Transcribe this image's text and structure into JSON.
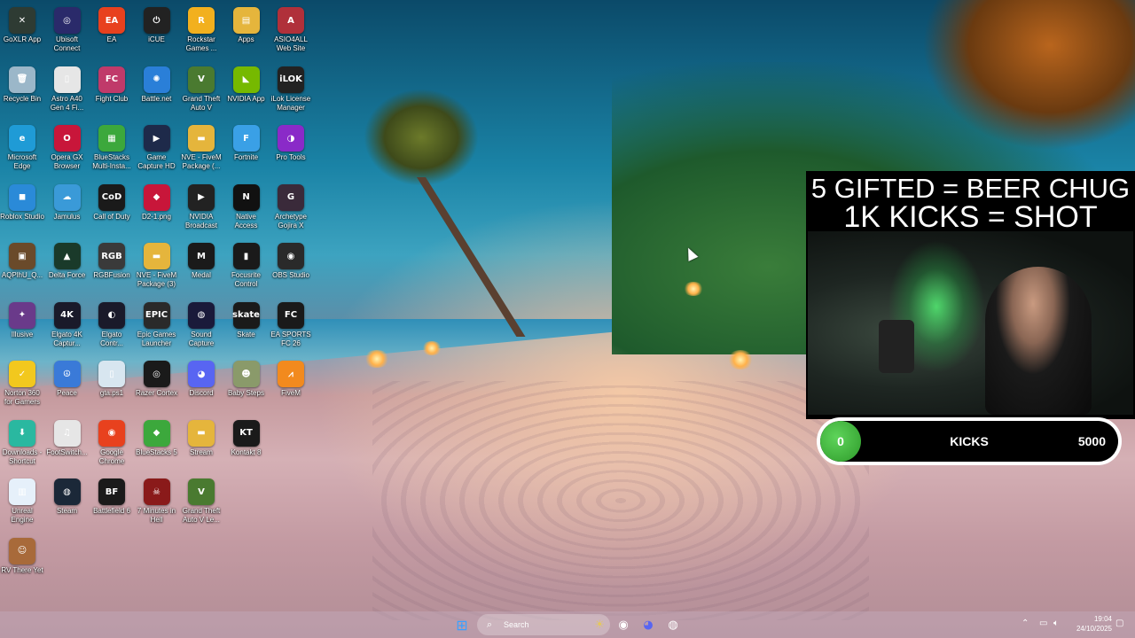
{
  "desktop": {
    "icons": [
      {
        "label": "GoXLR App",
        "glyph": "✕",
        "color": "#2e3b33"
      },
      {
        "label": "Ubisoft Connect",
        "glyph": "◎",
        "color": "#2a2a6a"
      },
      {
        "label": "EA",
        "glyph": "EA",
        "color": "#e8411e"
      },
      {
        "label": "iCUE",
        "glyph": "⏻",
        "color": "#222222"
      },
      {
        "label": "Rockstar Games ...",
        "glyph": "R",
        "color": "#f2b01e"
      },
      {
        "label": "Apps",
        "glyph": "▤",
        "color": "#e5b53c"
      },
      {
        "label": "ASIO4ALL Web Site",
        "glyph": "A",
        "color": "#b0303a"
      },
      {
        "label": "Recycle Bin",
        "glyph": "🗑",
        "color": "#9bb7c9"
      },
      {
        "label": "Astro A40 Gen 4 Fi...",
        "glyph": "▯",
        "color": "#e6e6e6"
      },
      {
        "label": "Fight Club",
        "glyph": "FC",
        "color": "#c03a6a"
      },
      {
        "label": "Battle.net",
        "glyph": "✺",
        "color": "#2a7fd8"
      },
      {
        "label": "Grand Theft Auto V",
        "glyph": "V",
        "color": "#4a7a30"
      },
      {
        "label": "NVIDIA App",
        "glyph": "◣",
        "color": "#76b900"
      },
      {
        "label": "iLok License Manager",
        "glyph": "iLOK",
        "color": "#222222"
      },
      {
        "label": "Microsoft Edge",
        "glyph": "e",
        "color": "#1f9bd6"
      },
      {
        "label": "Opera GX Browser",
        "glyph": "O",
        "color": "#c8163a"
      },
      {
        "label": "BlueStacks Multi-Insta...",
        "glyph": "▦",
        "color": "#3ca83c"
      },
      {
        "label": "Game Capture HD",
        "glyph": "▶",
        "color": "#1e2a4a"
      },
      {
        "label": "NVE - FiveM Package (...",
        "glyph": "▬",
        "color": "#e5b53c"
      },
      {
        "label": "Fortnite",
        "glyph": "F",
        "color": "#3aa0e6"
      },
      {
        "label": "Pro Tools",
        "glyph": "◑",
        "color": "#8a2ac8"
      },
      {
        "label": "Roblox Studio",
        "glyph": "◼",
        "color": "#2a8ad8"
      },
      {
        "label": "Jamulus",
        "glyph": "☁",
        "color": "#3a9ad8"
      },
      {
        "label": "Call of Duty",
        "glyph": "CoD",
        "color": "#1a1a1a"
      },
      {
        "label": "D2-1.png",
        "glyph": "◆",
        "color": "#c8163a"
      },
      {
        "label": "NVIDIA Broadcast",
        "glyph": "▶",
        "color": "#222222"
      },
      {
        "label": "Native Access",
        "glyph": "N",
        "color": "#111111"
      },
      {
        "label": "Archetype Gojira X",
        "glyph": "G",
        "color": "#3a2a3a"
      },
      {
        "label": "AQPlhU_Q...",
        "glyph": "▣",
        "color": "#6a4a2a"
      },
      {
        "label": "Delta Force",
        "glyph": "▲",
        "color": "#1a3a2a"
      },
      {
        "label": "RGBFusion",
        "glyph": "RGB",
        "color": "#3a3a3a"
      },
      {
        "label": "NVE - FiveM Package (3)",
        "glyph": "▬",
        "color": "#e5b53c"
      },
      {
        "label": "Medal",
        "glyph": "M",
        "color": "#1a1a1a"
      },
      {
        "label": "Focusrite Control",
        "glyph": "▮",
        "color": "#1a1a1a"
      },
      {
        "label": "OBS Studio",
        "glyph": "◉",
        "color": "#2a2a2a"
      },
      {
        "label": "Illusive",
        "glyph": "✦",
        "color": "#6a3a8a"
      },
      {
        "label": "Elgato 4K Captur...",
        "glyph": "4K",
        "color": "#1a1a2a"
      },
      {
        "label": "Elgato Contr...",
        "glyph": "◐",
        "color": "#1a1a2a"
      },
      {
        "label": "Epic Games Launcher",
        "glyph": "EPIC",
        "color": "#2a2a2a"
      },
      {
        "label": "Sound Capture",
        "glyph": "◍",
        "color": "#1a1a3a"
      },
      {
        "label": "Skate",
        "glyph": "skate",
        "color": "#1a1a1a"
      },
      {
        "label": "EA SPORTS FC 26",
        "glyph": "FC",
        "color": "#1a1a1a"
      },
      {
        "label": "Norton 360 for Gamers",
        "glyph": "✓",
        "color": "#f2c81e"
      },
      {
        "label": "Peace",
        "glyph": "☮",
        "color": "#3a7ad8"
      },
      {
        "label": "gta.ps1",
        "glyph": "▯",
        "color": "#d8e6f0"
      },
      {
        "label": "Razer Cortex",
        "glyph": "◎",
        "color": "#1a1a1a"
      },
      {
        "label": "Discord",
        "glyph": "◕",
        "color": "#5865f2"
      },
      {
        "label": "Baby Steps",
        "glyph": "☻",
        "color": "#8a9a6a"
      },
      {
        "label": "FiveM",
        "glyph": "⩘",
        "color": "#f28a1e"
      },
      {
        "label": "Downloads - Shortcut",
        "glyph": "⬇",
        "color": "#2ab8a0"
      },
      {
        "label": "FootSwitch...",
        "glyph": "♫",
        "color": "#e6e6e6"
      },
      {
        "label": "Google Chrome",
        "glyph": "◉",
        "color": "#e8411e"
      },
      {
        "label": "BlueStacks 5",
        "glyph": "◆",
        "color": "#3ca83c"
      },
      {
        "label": "Stream",
        "glyph": "▬",
        "color": "#e5b53c"
      },
      {
        "label": "Kontakt 8",
        "glyph": "KT",
        "color": "#1a1a1a"
      },
      {
        "label": "Unreal Engine",
        "glyph": "▥",
        "color": "#e6f0fa"
      },
      {
        "label": "Steam",
        "glyph": "◍",
        "color": "#1b2838"
      },
      {
        "label": "Battlefield 6",
        "glyph": "BF",
        "color": "#1a1a1a"
      },
      {
        "label": "7 Minutes in Hell",
        "glyph": "☠",
        "color": "#8a1a1a"
      },
      {
        "label": "Grand Theft Auto V Le...",
        "glyph": "V",
        "color": "#4a7a30"
      },
      {
        "label": "RV There Yet",
        "glyph": "☺",
        "color": "#a86a3a"
      }
    ]
  },
  "overlay": {
    "title_line1": "5 GIFTED = BEER CHUG",
    "title_line2": "1K KICKS = SHOT",
    "goal": {
      "label": "KICKS",
      "current": "0",
      "target": "5000",
      "progress": 0.0,
      "bar_color": "#2fa83a"
    }
  },
  "taskbar": {
    "search_placeholder": "Search",
    "pinned": [
      {
        "name": "start",
        "glyph": "⊞",
        "color": "#3aa0ff"
      },
      {
        "name": "widgets",
        "glyph": "☀",
        "color": "#e5c85a"
      },
      {
        "name": "obs",
        "glyph": "◉",
        "color": "#2a2a2a"
      },
      {
        "name": "discord",
        "glyph": "◕",
        "color": "#5865f2"
      },
      {
        "name": "steam",
        "glyph": "◍",
        "color": "#1b2838"
      }
    ],
    "time": "19:04",
    "date": "24/10/2025"
  }
}
